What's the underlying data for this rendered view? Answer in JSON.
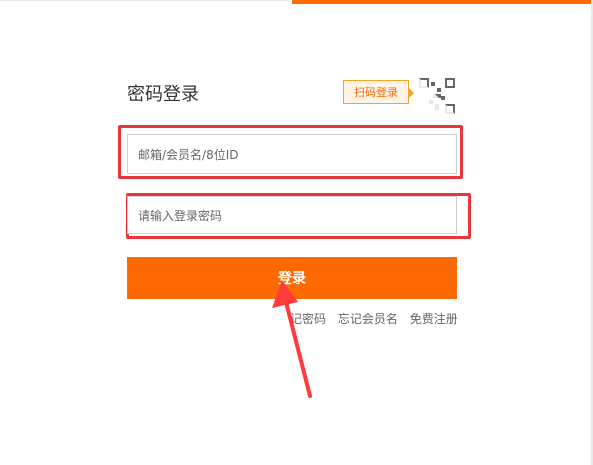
{
  "login": {
    "title": "密码登录",
    "qr_tip": "扫码登录",
    "username_placeholder": "邮箱/会员名/8位ID",
    "password_placeholder": "请输入登录密码",
    "submit_label": "登录",
    "links": {
      "forgot_password": "记密码",
      "forgot_username": "忘记会员名",
      "register": "免费注册"
    }
  },
  "colors": {
    "accent": "#ff6a00",
    "highlight": "#e8363b"
  },
  "icons": [
    "qr-code-icon",
    "annotation-arrow"
  ]
}
